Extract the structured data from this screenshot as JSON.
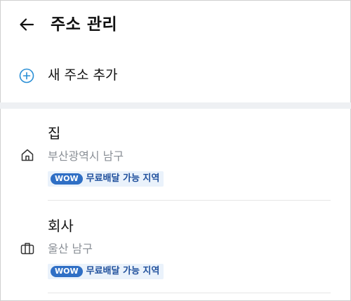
{
  "header": {
    "title": "주소 관리",
    "back_icon": "arrow-left-icon"
  },
  "add_address": {
    "label": "새 주소 추가",
    "icon": "plus-circle-icon",
    "accent_color": "#2a8fd6"
  },
  "addresses": [
    {
      "name": "집",
      "detail": "부산광역시 남구",
      "icon": "home-icon",
      "badge_pill": "WOW",
      "badge_text": "무료배달 가능 지역"
    },
    {
      "name": "회사",
      "detail": "울산 남구",
      "icon": "briefcase-icon",
      "badge_pill": "WOW",
      "badge_text": "무료배달 가능 지역"
    }
  ],
  "colors": {
    "badge_blue": "#2f6fc5",
    "badge_bg": "#eaf2fb",
    "detail_gray": "#8a8f96",
    "section_bg": "#eef0f3"
  }
}
